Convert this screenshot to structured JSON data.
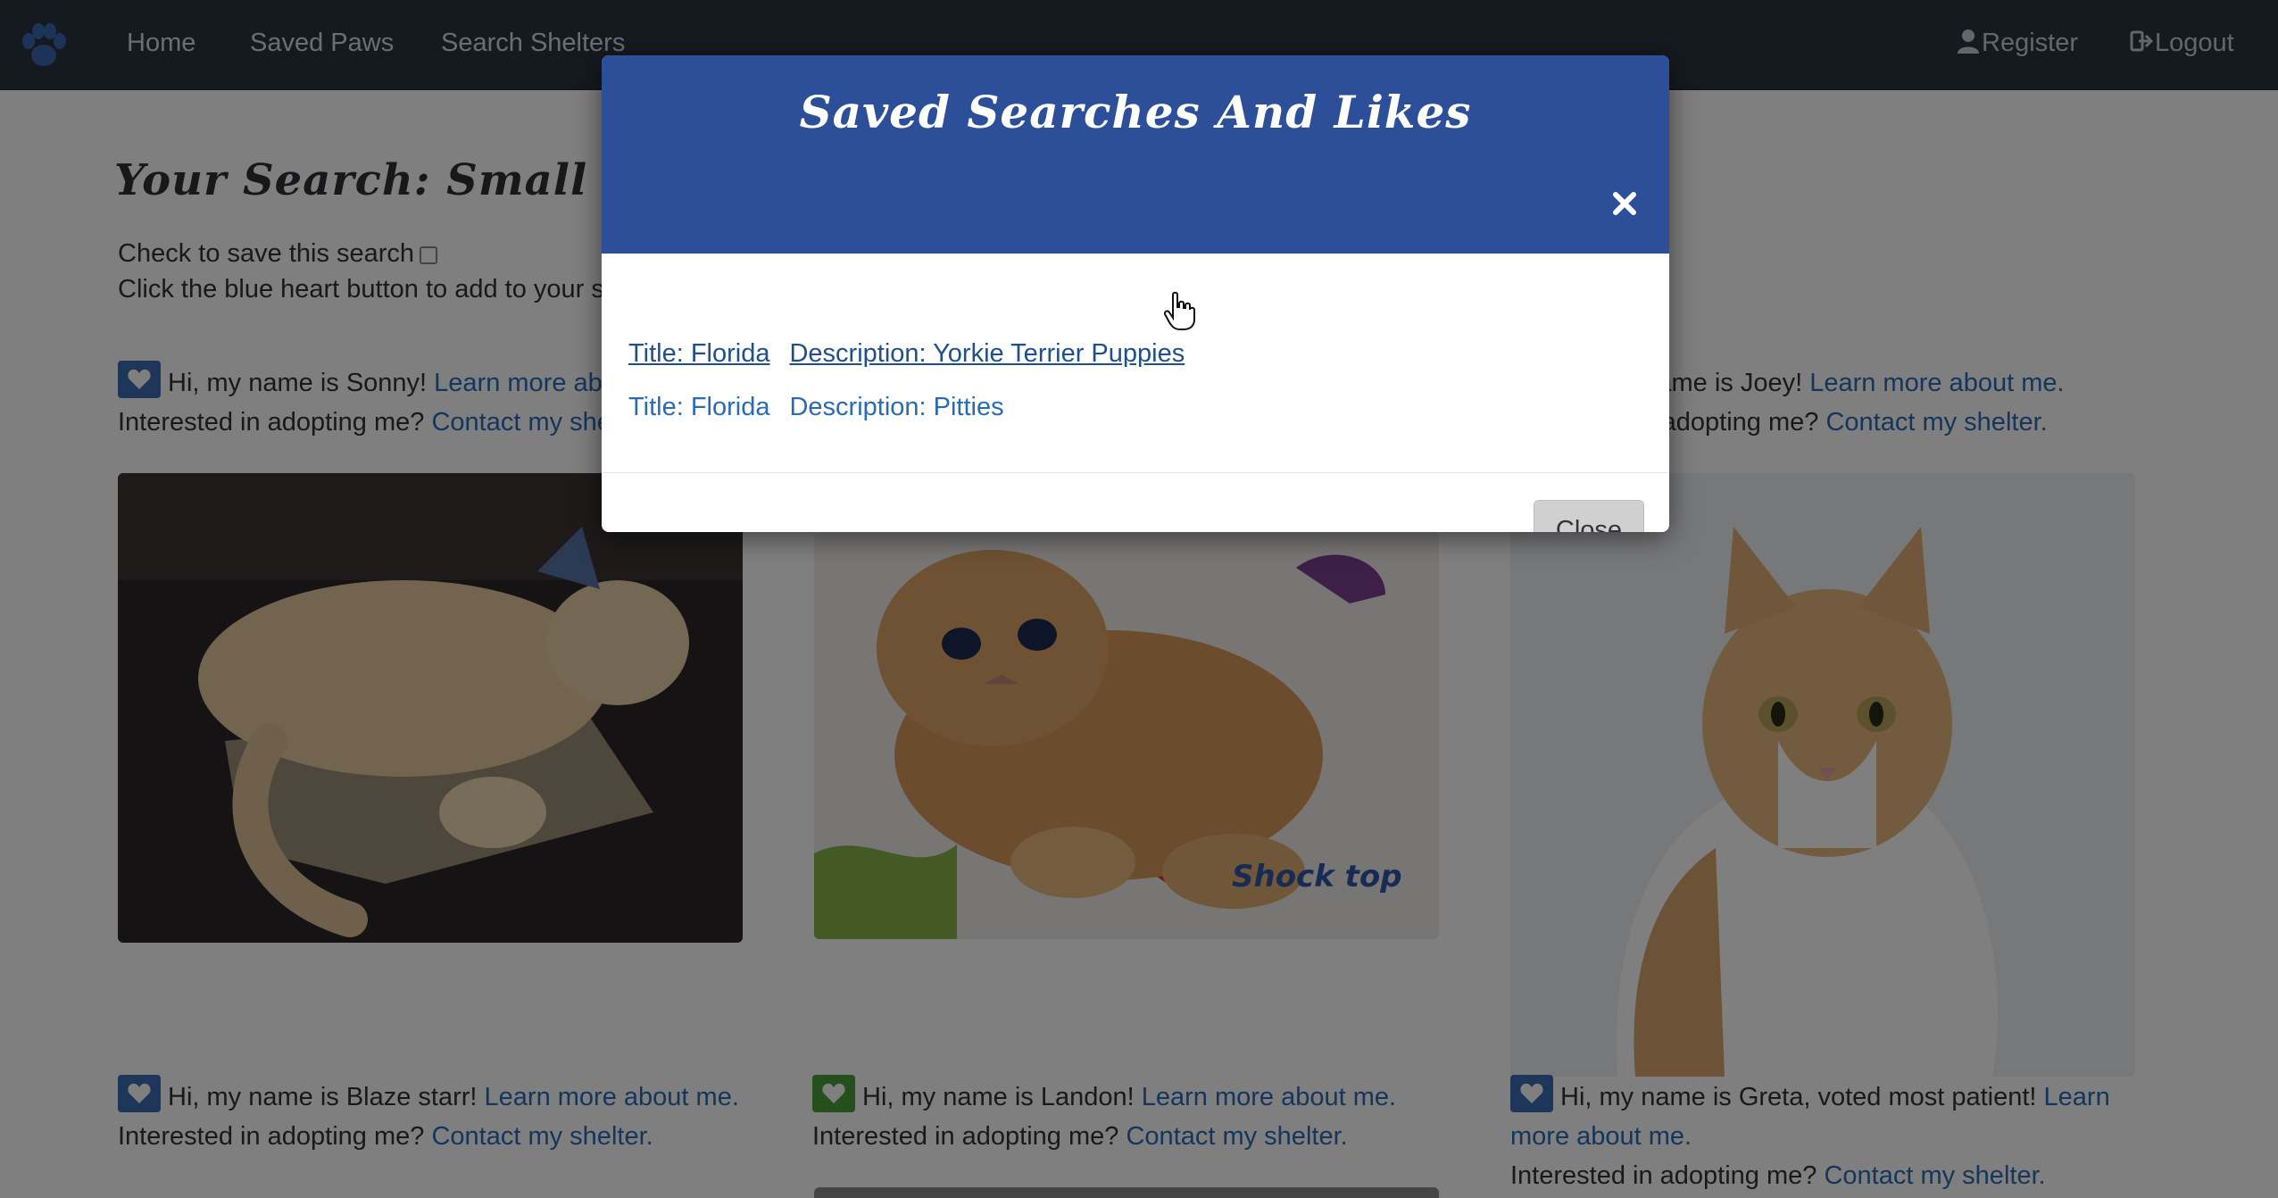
{
  "nav": {
    "logo_icon": "paw-icon",
    "links": [
      "Home",
      "Saved Paws",
      "Search Shelters"
    ],
    "register": "Register",
    "logout": "Logout"
  },
  "page": {
    "title": "Your Search: Small male cats",
    "save_search_label": "Check to save this search",
    "hint": "Click the blue heart button to add to your saved paws.",
    "cards": [
      {
        "intro": "Hi, my name is Sonny!",
        "learn": "Learn more about me.",
        "adopt": "Interested in adopting me?",
        "contact": "Contact my shelter."
      },
      {
        "intro": "Hi, my name is Joey!",
        "learn": "Learn more about me.",
        "adopt": "Interested in adopting me?",
        "contact": "Contact my shelter."
      },
      {
        "intro": "Hi, my name is Blaze starr!",
        "learn": "Learn more about me.",
        "adopt": "Interested in adopting me?",
        "contact": "Contact my shelter."
      },
      {
        "intro": "Hi, my name is Landon!",
        "learn": "Learn more about me.",
        "adopt": "Interested in adopting me?",
        "contact": "Contact my shelter."
      },
      {
        "intro": "Hi, my name is Greta, voted most patient!",
        "learn": "Learn more about me.",
        "adopt": "Interested in adopting me?",
        "contact": "Contact my shelter."
      }
    ],
    "photo_watermark": "Shock top"
  },
  "modal": {
    "title": "Saved Searches And Likes",
    "close_icon": "close-icon",
    "items": [
      {
        "title": "Title: Florida",
        "description": "Description: Yorkie Terrier Puppies"
      },
      {
        "title": "Title: Florida",
        "description": "Description: Pitties"
      }
    ],
    "close_button": "Close"
  },
  "colors": {
    "navbar": "#2b3440",
    "modal_header": "#2d4f9a",
    "link": "#2a6bb5",
    "heart_blue": "#3a6db5",
    "heart_green": "#4a9e3a"
  }
}
